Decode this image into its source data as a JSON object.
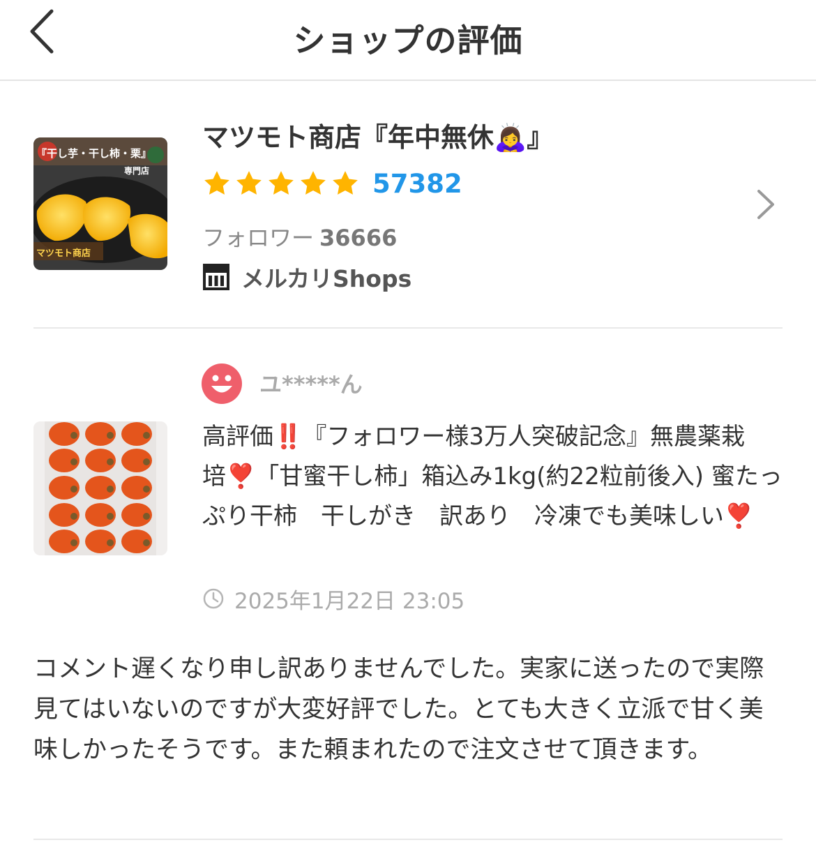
{
  "header": {
    "title": "ショップの評価",
    "back_icon": "chevron-left-icon"
  },
  "shop": {
    "name": "マツモト商店『年中無休🙇‍♀️』",
    "thumbnail": {
      "banner_text": "『干し芋・干し柿・栗』",
      "sub_text": "専門店",
      "shop_label": "マツモト商店"
    },
    "stars": 5,
    "rating_count": "57382",
    "followers_label": "フォロワー",
    "followers_count": "36666",
    "badge_icon": "storefront-icon",
    "badge_label": "メルカリShops",
    "accent_color": "#2196e8",
    "star_color": "#ffb400"
  },
  "review": {
    "avatar_icon": "smiley-avatar-icon",
    "avatar_color": "#ef5f6b",
    "reviewer_name": "ユ*****ん",
    "item_title": {
      "part1": "高評価",
      "bang": "‼️",
      "part2": "『フォロワー様3万人突破記念』無農薬栽培",
      "heart1": "❣️",
      "part3": "「甘蜜干し柿」箱込み1kg(約22粒前後入) 蜜たっぷり干柿　干しがき　訳あり　冷凍でも美味しい",
      "heart2": "❣️"
    },
    "date": "2025年1月22日 23:05",
    "comment": "コメント遅くなり申し訳ありませんでした。実家に送ったので実際見てはいないのですが大変好評でした。とても大きく立派で甘く美味しかったそうです。また頼まれたので注文させて頂きます。"
  }
}
